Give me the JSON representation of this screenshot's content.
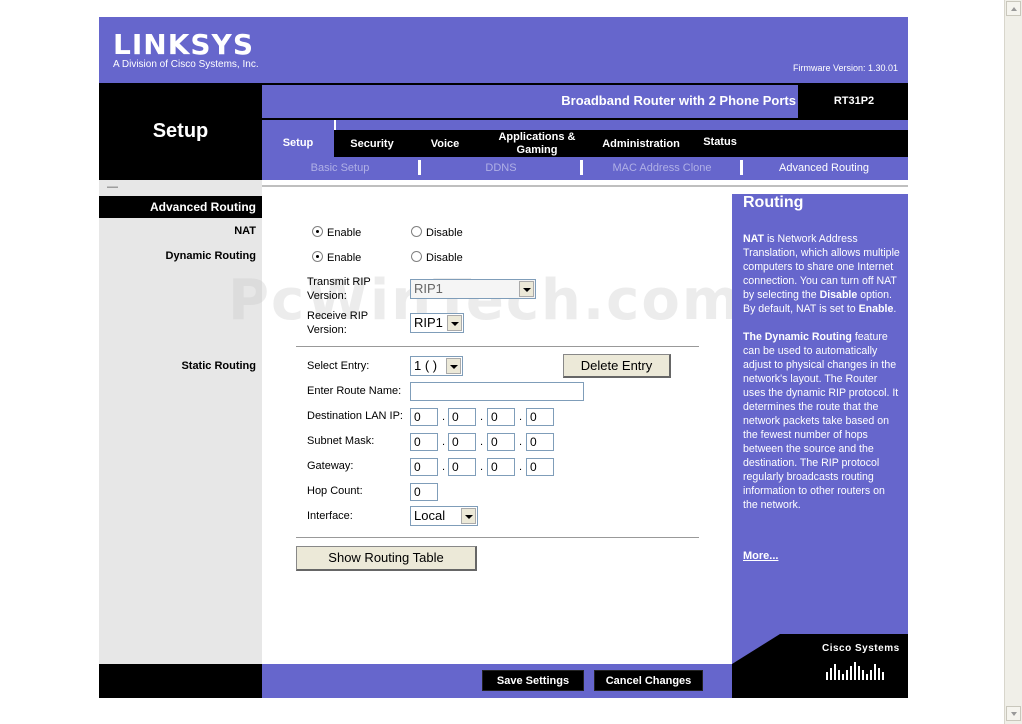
{
  "brand": {
    "logo": "LINKSYS",
    "subtitle": "A Division of Cisco Systems, Inc.",
    "firmware": "Firmware Version: 1.30.01"
  },
  "product": {
    "name": "Broadband Router with 2 Phone Ports",
    "model": "RT31P2"
  },
  "section_title": "Setup",
  "tabs": [
    {
      "label": "Setup",
      "active": true
    },
    {
      "label": "Security"
    },
    {
      "label": "Voice"
    },
    {
      "label": "Applications & Gaming"
    },
    {
      "label": "Administration"
    },
    {
      "label": "Status"
    }
  ],
  "subtabs": [
    {
      "label": "Basic Setup"
    },
    {
      "label": "DDNS"
    },
    {
      "label": "MAC Address Clone"
    },
    {
      "label": "Advanced Routing",
      "active": true
    }
  ],
  "sidebar": {
    "heading": "Advanced Routing",
    "nat": "NAT",
    "dynamic_routing": "Dynamic Routing",
    "static_routing": "Static Routing"
  },
  "nat": {
    "enable": "Enable",
    "disable": "Disable",
    "selected": "Enable"
  },
  "dynamic": {
    "enable": "Enable",
    "disable": "Disable",
    "selected": "Enable"
  },
  "rip": {
    "transmit_label_1": "Transmit RIP",
    "transmit_label_2": "Version:",
    "transmit_value": "RIP1",
    "receive_label_1": "Receive RIP",
    "receive_label_2": "Version:",
    "receive_value": "RIP1"
  },
  "static": {
    "select_entry_label": "Select Entry:",
    "select_entry_value": "1 ( )",
    "delete_button": "Delete Entry",
    "route_name_label": "Enter Route Name:",
    "route_name_value": "",
    "dest_label": "Destination LAN IP:",
    "dest": [
      "0",
      "0",
      "0",
      "0"
    ],
    "mask_label": "Subnet Mask:",
    "mask": [
      "0",
      "0",
      "0",
      "0"
    ],
    "gateway_label": "Gateway:",
    "gateway": [
      "0",
      "0",
      "0",
      "0"
    ],
    "hop_label": "Hop Count:",
    "hop_value": "0",
    "interface_label": "Interface:",
    "interface_value": "Local",
    "show_table_button": "Show Routing Table"
  },
  "help": {
    "title": "Routing",
    "nat_term": "NAT",
    "nat_text_1": " is Network Address Translation, which allows multiple computers to share one Internet connection. You can turn off NAT by selecting the ",
    "nat_disable": "Disable",
    "nat_text_2": " option. By default, NAT is set to ",
    "nat_enable": "Enable",
    "nat_text_3": ".",
    "dyn_term": "The Dynamic Routing",
    "dyn_text": " feature can be used to automatically adjust to physical changes in the network's layout. The Router uses the dynamic RIP protocol. It determines the route that the network packets take based on the fewest number of hops between the source and the destination. The RIP protocol regularly broadcasts routing information to other routers on the network.",
    "more": "More..."
  },
  "footer": {
    "save": "Save Settings",
    "cancel": "Cancel Changes"
  },
  "cisco": "Cisco Systems",
  "watermark": "PcWinTech.com",
  "colors": {
    "brand": "#6666cc",
    "dark": "#000000",
    "sidebar": "#e7e7e7"
  }
}
